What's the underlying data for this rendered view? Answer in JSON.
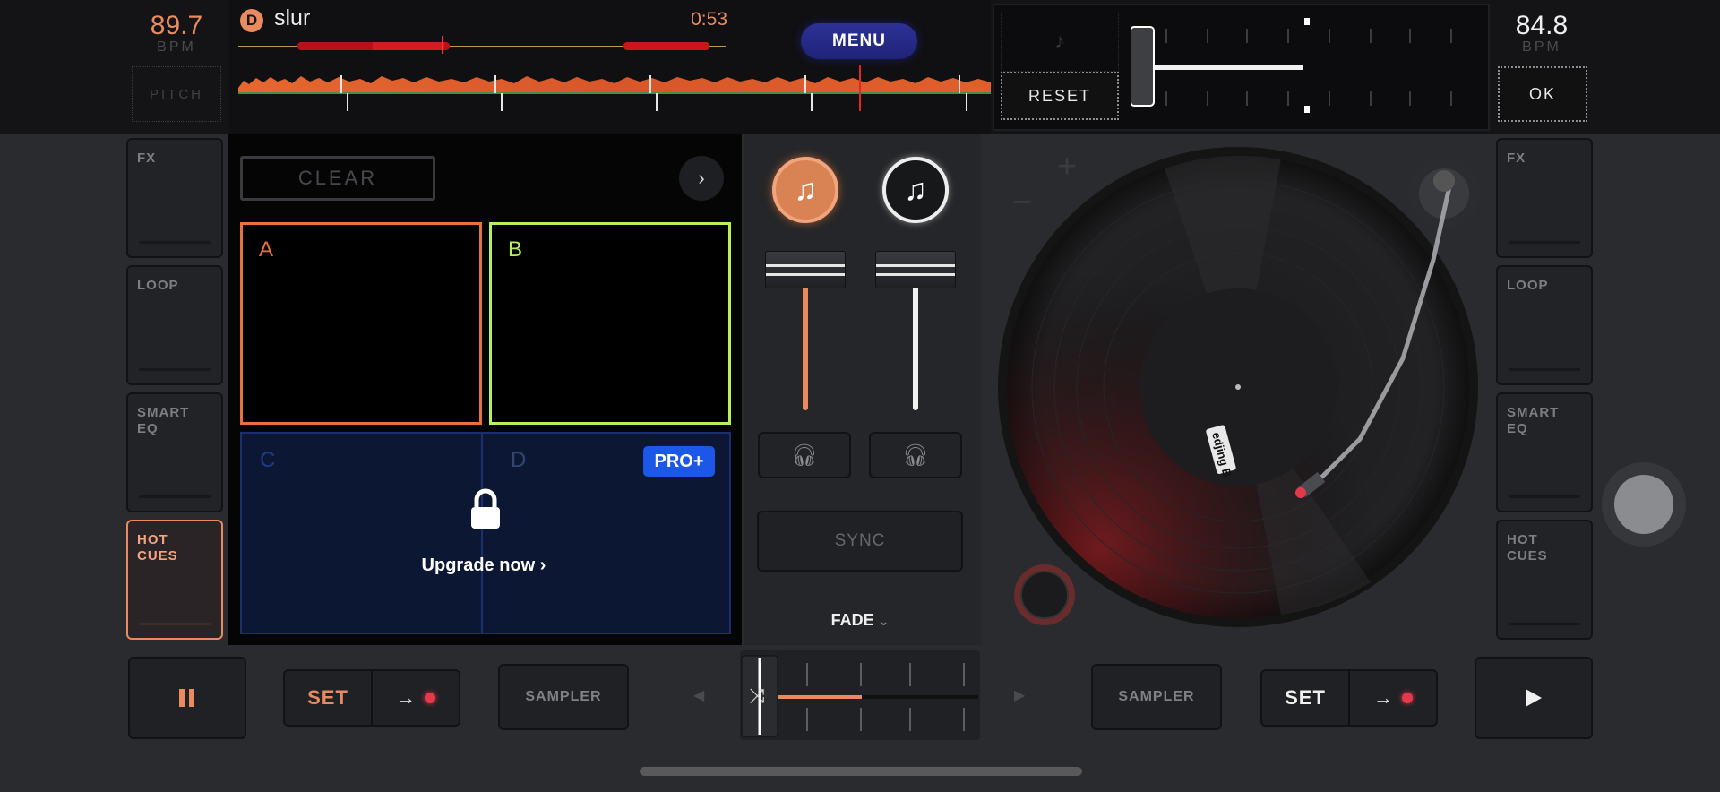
{
  "deck_left": {
    "bpm": "89.7",
    "bpm_label": "BPM",
    "pitch_label": "PITCH",
    "track_title": "slur",
    "track_badge": "D",
    "time": "0:53",
    "accent": "#e98a5f"
  },
  "deck_right": {
    "bpm": "84.8",
    "bpm_label": "BPM",
    "ok_label": "OK",
    "reset_label": "RESET",
    "pitch_level": 0.5
  },
  "menu_label": "MENU",
  "side_left": [
    "FX",
    "LOOP",
    "SMART EQ",
    "HOT CUES"
  ],
  "side_right": [
    "FX",
    "LOOP",
    "SMART EQ",
    "HOT CUES"
  ],
  "side_left_active": "HOT CUES",
  "pads": {
    "clear_label": "CLEAR",
    "items": [
      {
        "label": "A",
        "color": "#e7713f"
      },
      {
        "label": "B",
        "color": "#b8f05a"
      },
      {
        "label": "C",
        "color": "#1f3a8a"
      },
      {
        "label": "D",
        "color": "#36456e"
      }
    ],
    "pro_badge": "PRO+",
    "upgrade_label": "Upgrade now"
  },
  "mixer": {
    "sync_label": "SYNC",
    "fade_label": "FADE",
    "left_volume": 0.9,
    "right_volume": 0.9,
    "crossfader_position": 0.0
  },
  "bottom": {
    "set_label": "SET",
    "sampler_label": "SAMPLER",
    "pause_icon": "pause-icon",
    "play_icon": "play-icon"
  },
  "turntable": {
    "label_text": "edjing B"
  }
}
